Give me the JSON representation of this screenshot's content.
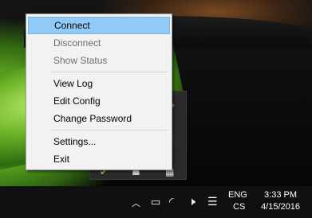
{
  "context_menu": {
    "items": [
      {
        "label": "Connect",
        "state": "highlighted"
      },
      {
        "label": "Disconnect",
        "state": "disabled"
      },
      {
        "label": "Show Status",
        "state": "disabled"
      },
      {
        "label": "View Log",
        "state": "enabled"
      },
      {
        "label": "Edit Config",
        "state": "enabled"
      },
      {
        "label": "Change Password",
        "state": "enabled"
      },
      {
        "label": "Settings...",
        "state": "enabled"
      },
      {
        "label": "Exit",
        "state": "enabled"
      }
    ]
  },
  "taskbar": {
    "language": "ENG",
    "layout": "CS",
    "time": "3:33 PM",
    "date": "4/15/2016"
  },
  "colors": {
    "highlight": "#91c9f7",
    "menu_bg": "#f2f2f2",
    "taskbar_bg": "#101010"
  }
}
